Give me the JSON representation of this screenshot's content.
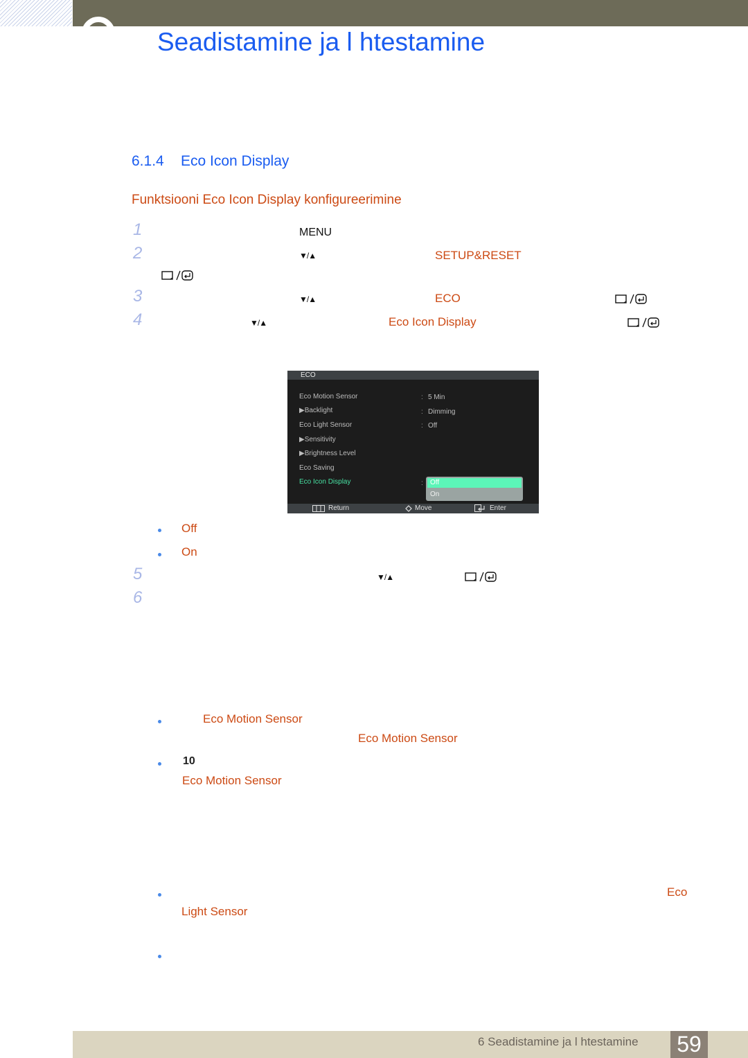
{
  "header": {
    "chapter_title": "Seadistamine ja l htestamine"
  },
  "section": {
    "number": "6.1.4",
    "title": "Eco Icon Display",
    "subheading": "Funktsiooni Eco Icon Display konfigureerimine"
  },
  "steps": [
    {
      "num": "1",
      "keyword": "MENU"
    },
    {
      "num": "2",
      "nav": "▼/▲",
      "target": "SETUP&RESET",
      "button": "enter"
    },
    {
      "num": "3",
      "nav": "▼/▲",
      "target": "ECO",
      "button": "enter"
    },
    {
      "num": "4",
      "nav": "▼/▲",
      "target": "Eco Icon Display",
      "button": "enter"
    },
    {
      "num": "5",
      "nav": "▼/▲",
      "button": "enter"
    },
    {
      "num": "6"
    }
  ],
  "osd": {
    "title": "ECO",
    "items": [
      {
        "label": "Eco Motion Sensor",
        "arrow": false,
        "value": "5 Min"
      },
      {
        "label": "Backlight",
        "arrow": true,
        "value": "Dimming"
      },
      {
        "label": "Eco Light Sensor",
        "arrow": false,
        "value": "Off"
      },
      {
        "label": "Sensitivity",
        "arrow": true,
        "value": ""
      },
      {
        "label": "Brightness Level",
        "arrow": true,
        "value": ""
      },
      {
        "label": "Eco Saving",
        "arrow": false,
        "value": ""
      },
      {
        "label": "Eco Icon Display",
        "arrow": false,
        "value": "",
        "active": true
      }
    ],
    "dropdown": {
      "options": [
        "Off",
        "On"
      ],
      "selected": "Off"
    },
    "footer": {
      "return_label": "Return",
      "move_label": "Move",
      "enter_label": "Enter"
    }
  },
  "options_list": [
    "Off",
    "On"
  ],
  "notes": {
    "motion_sensor_1": "Eco Motion Sensor",
    "motion_sensor_2": "Eco Motion Sensor",
    "minutes_value": "10",
    "motion_sensor_3": "Eco Motion Sensor",
    "light_sensor_a": "Eco",
    "light_sensor_b": "Light Sensor"
  },
  "footer": {
    "chapter_label": "6 Seadistamine ja l htestamine",
    "page_number": "59"
  },
  "colors": {
    "heading_blue": "#1a5cf0",
    "keyword_orange": "#cc4a14",
    "osd_active_green": "#47e0a2",
    "osd_selected": "#5cf5b8",
    "topbar": "#6d6b58",
    "footer_bar": "#dbd5c0",
    "page_box": "#8b8176"
  }
}
